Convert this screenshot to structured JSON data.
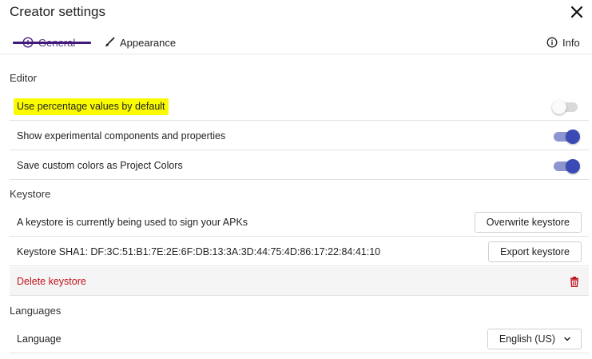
{
  "dialog": {
    "title": "Creator settings",
    "close_icon": "close-icon"
  },
  "tabs": [
    {
      "label": "General",
      "icon": "plus-circle-icon",
      "active": true
    },
    {
      "label": "Appearance",
      "icon": "brush-icon",
      "active": false
    },
    {
      "label": "Info",
      "icon": "info-icon",
      "active": false
    }
  ],
  "editor": {
    "title": "Editor",
    "rows": [
      {
        "label": "Use percentage values by default",
        "enabled": false,
        "highlighted": true
      },
      {
        "label": "Show experimental components and properties",
        "enabled": true
      },
      {
        "label": "Save custom colors as Project Colors",
        "enabled": true
      }
    ]
  },
  "keystore": {
    "title": "Keystore",
    "status_text": "A keystore is currently being used to sign your APKs",
    "overwrite_label": "Overwrite keystore",
    "sha_text": "Keystore SHA1: DF:3C:51:B1:7E:2E:6F:DB:13:3A:3D:44:75:4D:86:17:22:84:41:10",
    "export_label": "Export keystore",
    "delete_label": "Delete keystore"
  },
  "languages": {
    "title": "Languages",
    "language_label": "Language",
    "selected": "English (US)"
  },
  "colors": {
    "accent": "#3b4bb5",
    "danger": "#c0131c",
    "highlight": "#fbfb00",
    "tab_active": "#4b1f86"
  }
}
